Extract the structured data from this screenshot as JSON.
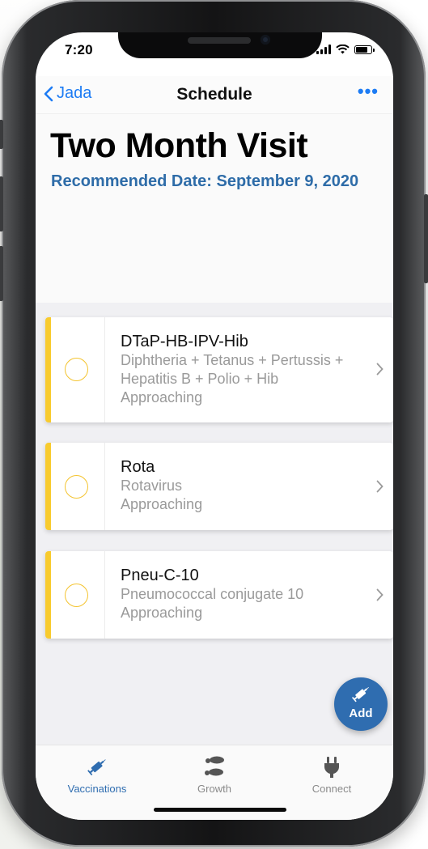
{
  "status_bar": {
    "time": "7:20"
  },
  "nav": {
    "back_label": "Jada",
    "title": "Schedule",
    "more_label": "•••"
  },
  "visit": {
    "title": "Two Month Visit",
    "recommended_date": "Recommended Date: September 9, 2020"
  },
  "vaccines": [
    {
      "name": "DTaP-HB-IPV-Hib",
      "description": "Diphtheria + Tetanus + Pertussis + Hepatitis B + Polio + Hib",
      "status": "Approaching"
    },
    {
      "name": "Rota",
      "description": "Rotavirus",
      "status": "Approaching"
    },
    {
      "name": "Pneu-C-10",
      "description": "Pneumococcal conjugate 10",
      "status": "Approaching"
    }
  ],
  "fab": {
    "label": "Add",
    "icon": "syringe-icon"
  },
  "tabs": [
    {
      "label": "Vaccinations",
      "icon": "syringe-icon",
      "active": true
    },
    {
      "label": "Growth",
      "icon": "footprints-icon",
      "active": false
    },
    {
      "label": "Connect",
      "icon": "plug-icon",
      "active": false
    }
  ],
  "colors": {
    "accent_blue": "#1d7cf4",
    "heading_blue": "#2e6ca8",
    "status_yellow": "#f8cb2e",
    "fab_blue": "#2f6db0",
    "tab_inactive": "#8a8a8a"
  }
}
